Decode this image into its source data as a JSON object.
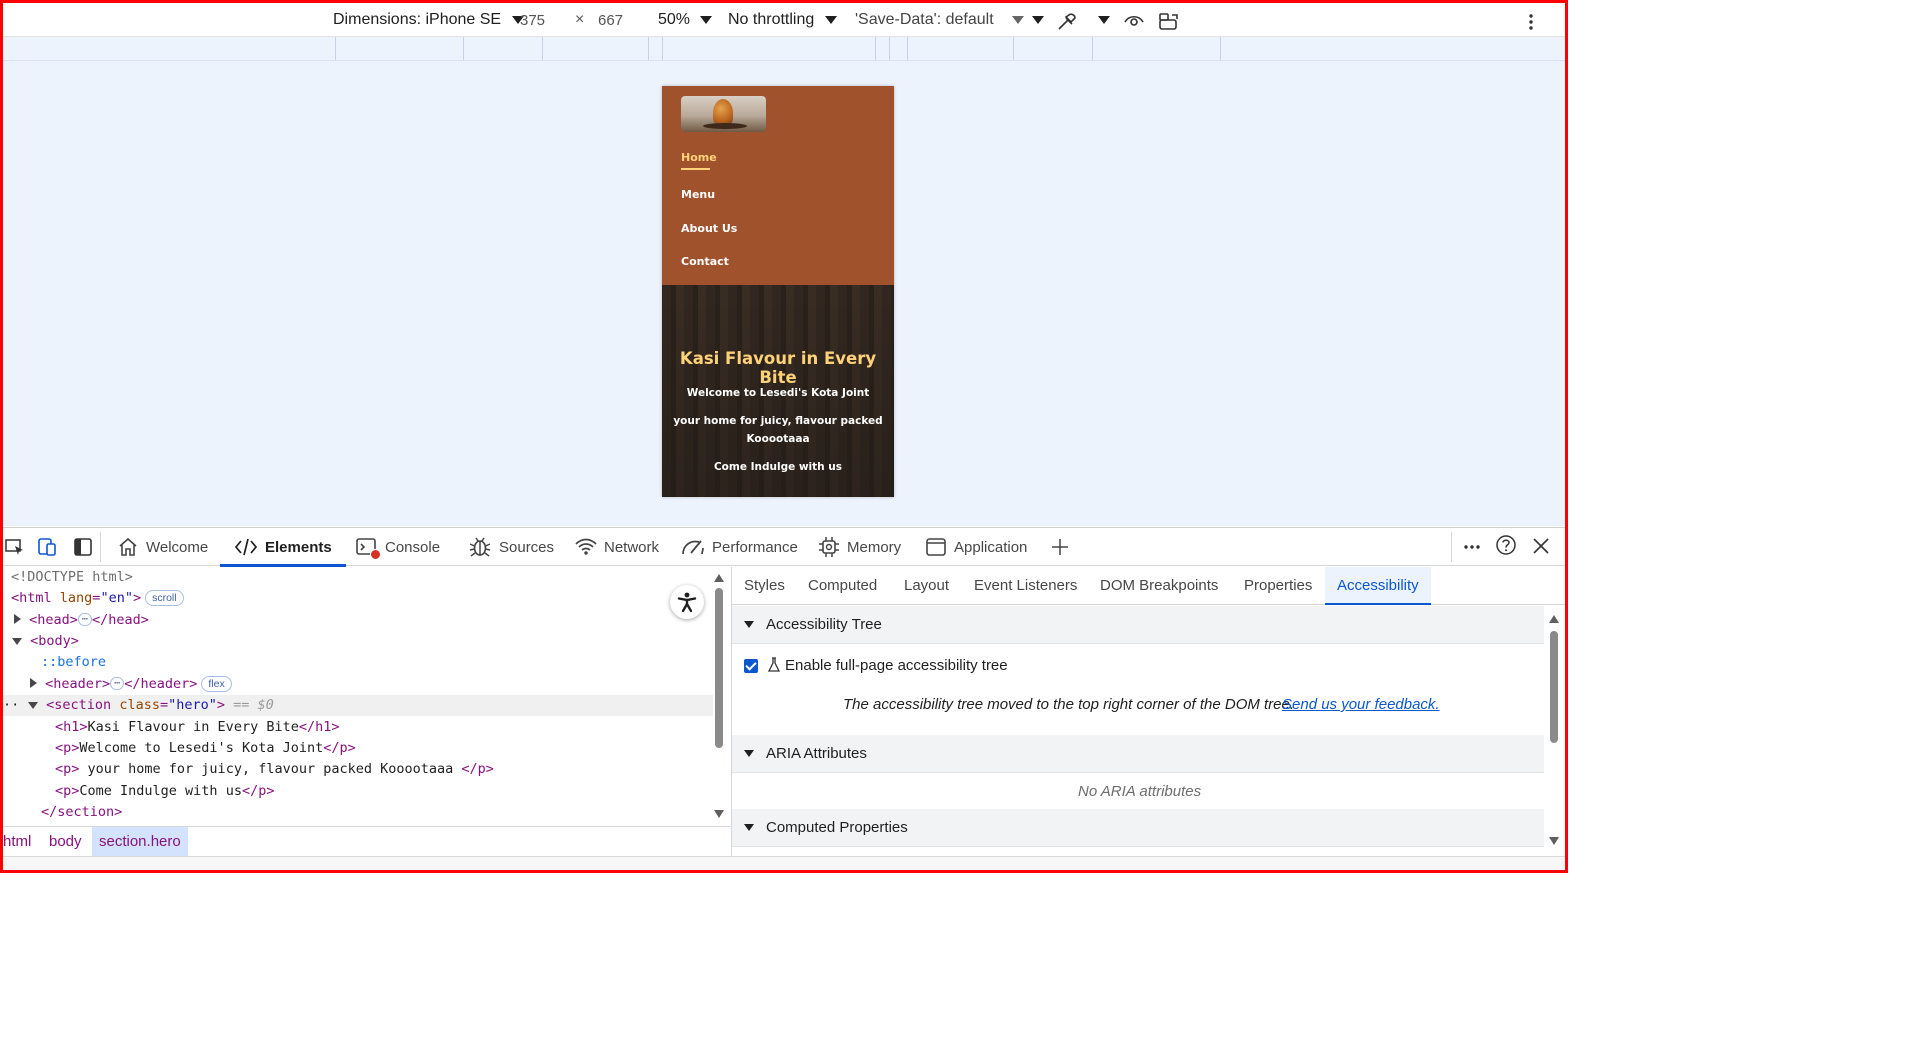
{
  "device_toolbar": {
    "dimensions_label": "Dimensions: iPhone SE",
    "width": "375",
    "times": "×",
    "height": "667",
    "zoom": "50%",
    "throttling": "No throttling",
    "save_data": "'Save-Data': default"
  },
  "site": {
    "nav": [
      "Home",
      "Menu",
      "About Us",
      "Contact"
    ],
    "active_nav": "Home",
    "hero": {
      "title": "Kasi Flavour in Every Bite",
      "p1": "Welcome to Lesedi's Kota Joint",
      "p2": "your home for juicy, flavour packed Kooootaaa",
      "p3": "Come Indulge with us"
    },
    "colors": {
      "header_bg": "#a0522d",
      "accent": "#ffd27a"
    }
  },
  "devtools": {
    "tabs": [
      "Welcome",
      "Elements",
      "Console",
      "Sources",
      "Network",
      "Performance",
      "Memory",
      "Application"
    ],
    "active_tab": "Elements",
    "dom": {
      "doctype": "<!DOCTYPE html>",
      "html_open": "<html",
      "lang_attr": "lang",
      "lang_val": "\"en\"",
      "close_gt": ">",
      "scroll_badge": "scroll",
      "head_open": "<head>",
      "head_close": "</head>",
      "body_open": "<body>",
      "before": "::before",
      "header_open": "<header>",
      "header_close": "</header>",
      "flex_badge": "flex",
      "section_open": "<section",
      "class_attr": "class",
      "class_val": "\"hero\"",
      "eq_ref": "== $0",
      "h1_open": "<h1>",
      "h1_text": "Kasi Flavour in Every Bite",
      "h1_close": "</h1>",
      "p_open": "<p>",
      "p_close": "</p>",
      "p1_text": "Welcome to Lesedi's Kota Joint",
      "p2_text": " your home for juicy, flavour packed Kooootaaa ",
      "p3_text": "Come Indulge with us",
      "section_close": "</section>",
      "ellipsis": "⋯"
    },
    "breadcrumbs": [
      "html",
      "body",
      "section.hero"
    ],
    "sidebar": {
      "tabs": [
        "Styles",
        "Computed",
        "Layout",
        "Event Listeners",
        "DOM Breakpoints",
        "Properties",
        "Accessibility"
      ],
      "active_tab": "Accessibility",
      "sections": {
        "tree": "Accessibility Tree",
        "aria": "ARIA Attributes",
        "computed": "Computed Properties"
      },
      "checkbox_label": "Enable full-page accessibility tree",
      "checkbox_checked": true,
      "notice": "The accessibility tree moved to the top right corner of the DOM tree.",
      "feedback_link": "Send us your feedback.",
      "no_aria": "No ARIA attributes"
    }
  }
}
